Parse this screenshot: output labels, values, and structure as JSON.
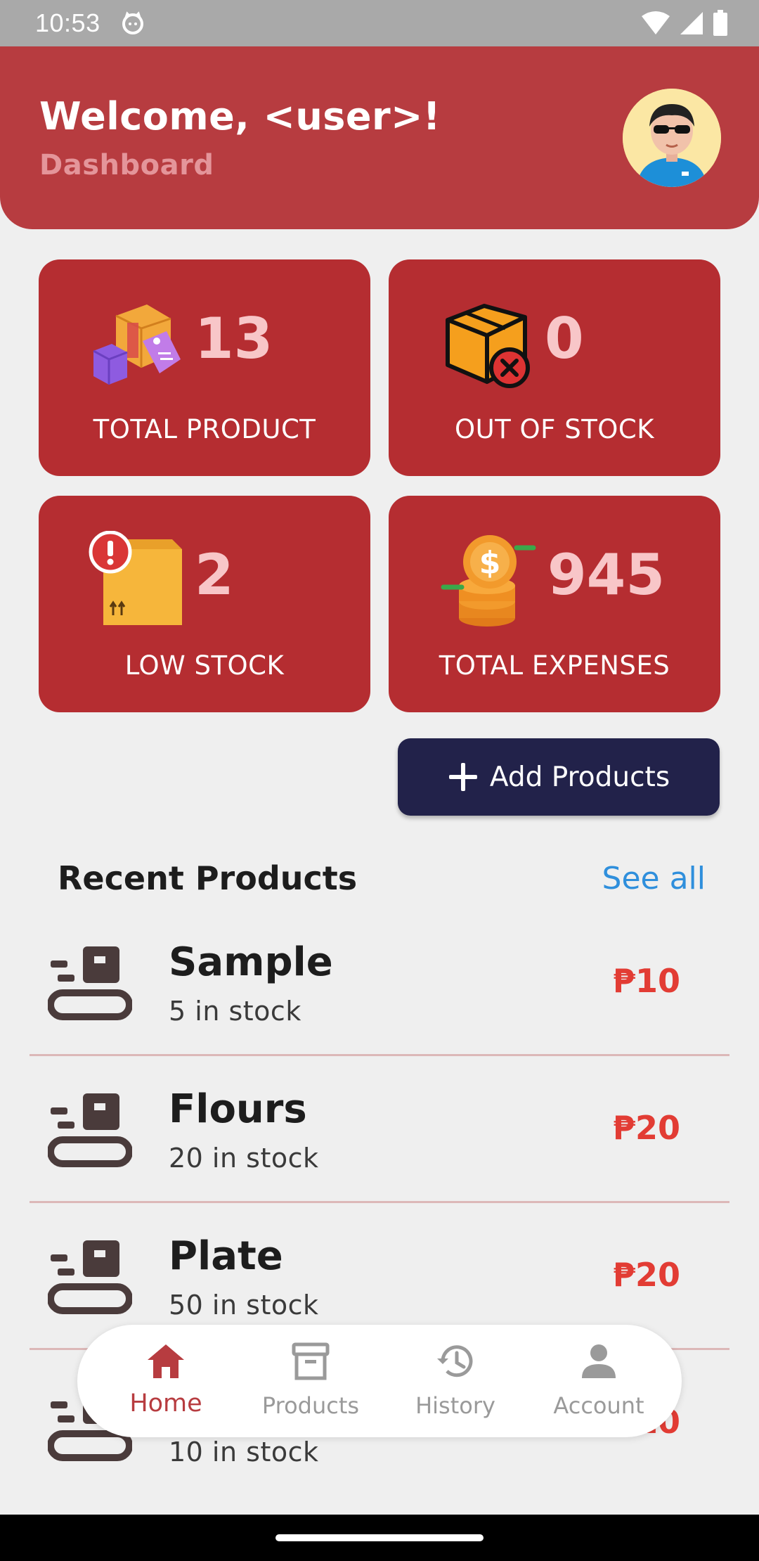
{
  "status_bar": {
    "time": "10:53"
  },
  "header": {
    "welcome": "Welcome, <user>!",
    "subtitle": "Dashboard"
  },
  "stats": [
    {
      "value": "13",
      "label": "TOTAL PRODUCT",
      "icon": "boxes-tag-icon"
    },
    {
      "value": "0",
      "label": "OUT OF STOCK",
      "icon": "box-x-icon"
    },
    {
      "value": "2",
      "label": "LOW STOCK",
      "icon": "box-alert-icon"
    },
    {
      "value": "945",
      "label": "TOTAL EXPENSES",
      "icon": "coins-icon"
    }
  ],
  "add_button": {
    "label": "Add Products"
  },
  "recent": {
    "title": "Recent Products",
    "see_all": "See all",
    "items": [
      {
        "name": "Sample",
        "stock": "5 in stock",
        "price": "₱10"
      },
      {
        "name": "Flours",
        "stock": "20 in stock",
        "price": "₱20"
      },
      {
        "name": "Plate",
        "stock": "50 in stock",
        "price": "₱20"
      },
      {
        "name": "",
        "stock": "10 in stock",
        "price": "₱10"
      }
    ]
  },
  "nav": {
    "items": [
      {
        "label": "Home",
        "icon": "home-icon",
        "active": true
      },
      {
        "label": "Products",
        "icon": "archive-icon"
      },
      {
        "label": "History",
        "icon": "history-icon"
      },
      {
        "label": "Account",
        "icon": "person-icon"
      }
    ]
  },
  "colors": {
    "header": "#b73c40",
    "card": "#b52d31",
    "button": "#22224a",
    "price": "#e23c34",
    "link": "#2f8fdc"
  }
}
